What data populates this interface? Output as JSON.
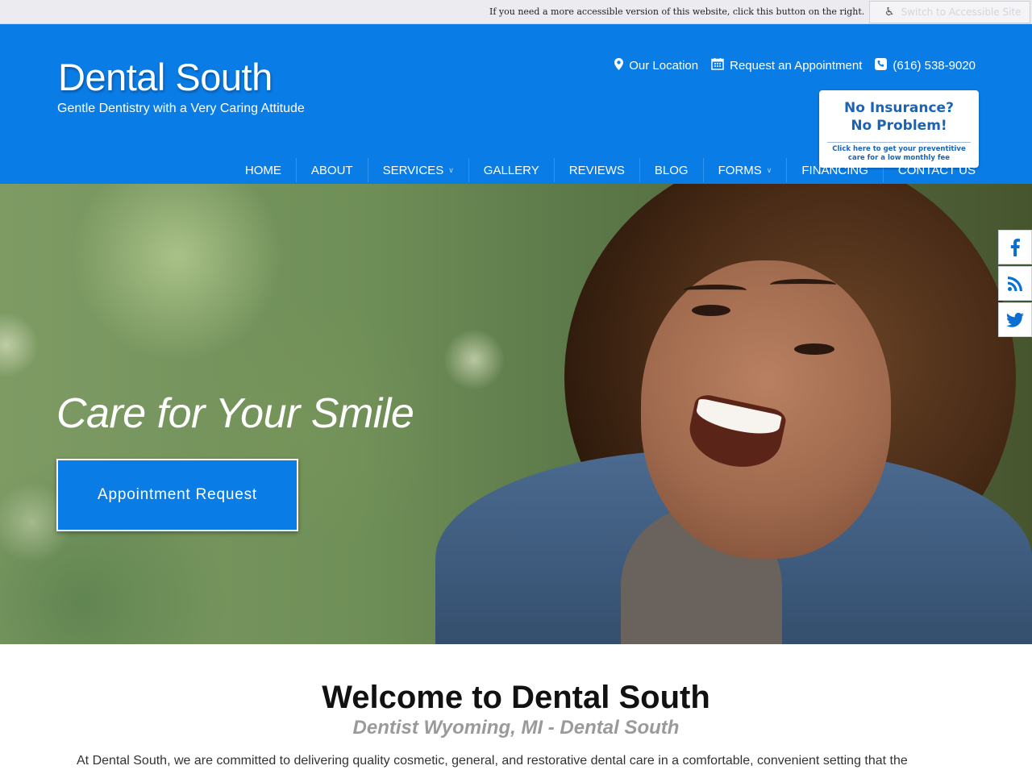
{
  "accessibility": {
    "notice": "If you need a more accessible version of this website, click this button on the right.",
    "button_label": "Switch to Accessible Site",
    "icon": "wheelchair-icon"
  },
  "header": {
    "logo": "Dental South",
    "tagline": "Gentle Dentistry with a Very Caring Attitude",
    "top_links": {
      "location": "Our Location",
      "appointment": "Request an Appointment",
      "phone": "(616) 538-9020"
    },
    "insurance_badge": {
      "headline_1": "No Insurance?",
      "headline_2": "No Problem!",
      "sub_1": "Click here to get your preventitive",
      "sub_2": "care for a low monthly fee"
    }
  },
  "nav": {
    "home": "HOME",
    "about": "ABOUT",
    "services": "SERVICES",
    "gallery": "GALLERY",
    "reviews": "REVIEWS",
    "blog": "BLOG",
    "forms": "FORMS",
    "financing": "FINANCING",
    "contact": "CONTACT US"
  },
  "hero": {
    "title": "Care for Your Smile",
    "button": "Appointment Request"
  },
  "social": {
    "facebook": "f",
    "rss": "RSS",
    "twitter": "twitter"
  },
  "welcome": {
    "title": "Welcome to Dental South",
    "subtitle": "Dentist Wyoming, MI - Dental South",
    "body": "At Dental South, we are committed to delivering quality cosmetic, general, and restorative dental care in a comfortable, convenient setting that the"
  },
  "colors": {
    "brand_blue": "#0a7ce6",
    "badge_text": "#1a64b8"
  }
}
